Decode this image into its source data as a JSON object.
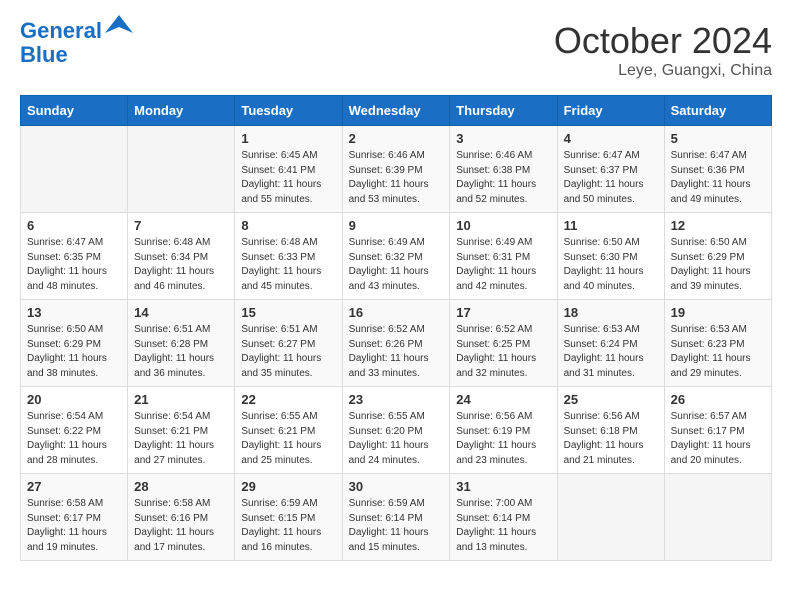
{
  "header": {
    "logo_line1": "General",
    "logo_line2": "Blue",
    "month_title": "October 2024",
    "location": "Leye, Guangxi, China"
  },
  "columns": [
    "Sunday",
    "Monday",
    "Tuesday",
    "Wednesday",
    "Thursday",
    "Friday",
    "Saturday"
  ],
  "weeks": [
    [
      {
        "day": "",
        "info": ""
      },
      {
        "day": "",
        "info": ""
      },
      {
        "day": "1",
        "info": "Sunrise: 6:45 AM\nSunset: 6:41 PM\nDaylight: 11 hours and 55 minutes."
      },
      {
        "day": "2",
        "info": "Sunrise: 6:46 AM\nSunset: 6:39 PM\nDaylight: 11 hours and 53 minutes."
      },
      {
        "day": "3",
        "info": "Sunrise: 6:46 AM\nSunset: 6:38 PM\nDaylight: 11 hours and 52 minutes."
      },
      {
        "day": "4",
        "info": "Sunrise: 6:47 AM\nSunset: 6:37 PM\nDaylight: 11 hours and 50 minutes."
      },
      {
        "day": "5",
        "info": "Sunrise: 6:47 AM\nSunset: 6:36 PM\nDaylight: 11 hours and 49 minutes."
      }
    ],
    [
      {
        "day": "6",
        "info": "Sunrise: 6:47 AM\nSunset: 6:35 PM\nDaylight: 11 hours and 48 minutes."
      },
      {
        "day": "7",
        "info": "Sunrise: 6:48 AM\nSunset: 6:34 PM\nDaylight: 11 hours and 46 minutes."
      },
      {
        "day": "8",
        "info": "Sunrise: 6:48 AM\nSunset: 6:33 PM\nDaylight: 11 hours and 45 minutes."
      },
      {
        "day": "9",
        "info": "Sunrise: 6:49 AM\nSunset: 6:32 PM\nDaylight: 11 hours and 43 minutes."
      },
      {
        "day": "10",
        "info": "Sunrise: 6:49 AM\nSunset: 6:31 PM\nDaylight: 11 hours and 42 minutes."
      },
      {
        "day": "11",
        "info": "Sunrise: 6:50 AM\nSunset: 6:30 PM\nDaylight: 11 hours and 40 minutes."
      },
      {
        "day": "12",
        "info": "Sunrise: 6:50 AM\nSunset: 6:29 PM\nDaylight: 11 hours and 39 minutes."
      }
    ],
    [
      {
        "day": "13",
        "info": "Sunrise: 6:50 AM\nSunset: 6:29 PM\nDaylight: 11 hours and 38 minutes."
      },
      {
        "day": "14",
        "info": "Sunrise: 6:51 AM\nSunset: 6:28 PM\nDaylight: 11 hours and 36 minutes."
      },
      {
        "day": "15",
        "info": "Sunrise: 6:51 AM\nSunset: 6:27 PM\nDaylight: 11 hours and 35 minutes."
      },
      {
        "day": "16",
        "info": "Sunrise: 6:52 AM\nSunset: 6:26 PM\nDaylight: 11 hours and 33 minutes."
      },
      {
        "day": "17",
        "info": "Sunrise: 6:52 AM\nSunset: 6:25 PM\nDaylight: 11 hours and 32 minutes."
      },
      {
        "day": "18",
        "info": "Sunrise: 6:53 AM\nSunset: 6:24 PM\nDaylight: 11 hours and 31 minutes."
      },
      {
        "day": "19",
        "info": "Sunrise: 6:53 AM\nSunset: 6:23 PM\nDaylight: 11 hours and 29 minutes."
      }
    ],
    [
      {
        "day": "20",
        "info": "Sunrise: 6:54 AM\nSunset: 6:22 PM\nDaylight: 11 hours and 28 minutes."
      },
      {
        "day": "21",
        "info": "Sunrise: 6:54 AM\nSunset: 6:21 PM\nDaylight: 11 hours and 27 minutes."
      },
      {
        "day": "22",
        "info": "Sunrise: 6:55 AM\nSunset: 6:21 PM\nDaylight: 11 hours and 25 minutes."
      },
      {
        "day": "23",
        "info": "Sunrise: 6:55 AM\nSunset: 6:20 PM\nDaylight: 11 hours and 24 minutes."
      },
      {
        "day": "24",
        "info": "Sunrise: 6:56 AM\nSunset: 6:19 PM\nDaylight: 11 hours and 23 minutes."
      },
      {
        "day": "25",
        "info": "Sunrise: 6:56 AM\nSunset: 6:18 PM\nDaylight: 11 hours and 21 minutes."
      },
      {
        "day": "26",
        "info": "Sunrise: 6:57 AM\nSunset: 6:17 PM\nDaylight: 11 hours and 20 minutes."
      }
    ],
    [
      {
        "day": "27",
        "info": "Sunrise: 6:58 AM\nSunset: 6:17 PM\nDaylight: 11 hours and 19 minutes."
      },
      {
        "day": "28",
        "info": "Sunrise: 6:58 AM\nSunset: 6:16 PM\nDaylight: 11 hours and 17 minutes."
      },
      {
        "day": "29",
        "info": "Sunrise: 6:59 AM\nSunset: 6:15 PM\nDaylight: 11 hours and 16 minutes."
      },
      {
        "day": "30",
        "info": "Sunrise: 6:59 AM\nSunset: 6:14 PM\nDaylight: 11 hours and 15 minutes."
      },
      {
        "day": "31",
        "info": "Sunrise: 7:00 AM\nSunset: 6:14 PM\nDaylight: 11 hours and 13 minutes."
      },
      {
        "day": "",
        "info": ""
      },
      {
        "day": "",
        "info": ""
      }
    ]
  ]
}
